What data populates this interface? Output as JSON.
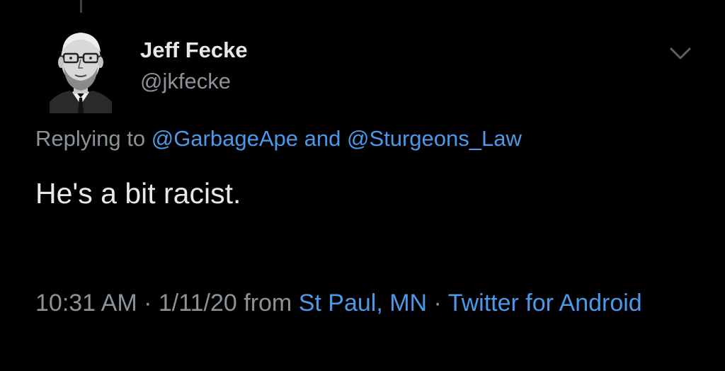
{
  "author": {
    "name": "Jeff Fecke",
    "handle": "@jkfecke",
    "avatar_icon": "avatar-portrait"
  },
  "menu": {
    "icon": "chevron-down-icon"
  },
  "reply": {
    "prefix": "Replying to",
    "mention_1": "@GarbageApe",
    "conjunction": "and",
    "mention_2": "@Sturgeons_Law"
  },
  "tweet": {
    "text": "He's a bit racist."
  },
  "meta": {
    "time": "10:31 AM",
    "sep1": " · ",
    "date": "1/11/20",
    "from_word": "from",
    "location": "St Paul, MN",
    "sep2": " · ",
    "source": "Twitter for Android"
  },
  "colors": {
    "background": "#000000",
    "link": "#4b99e8",
    "secondary_text": "#8b9298",
    "primary_text": "#e8e8e8"
  }
}
